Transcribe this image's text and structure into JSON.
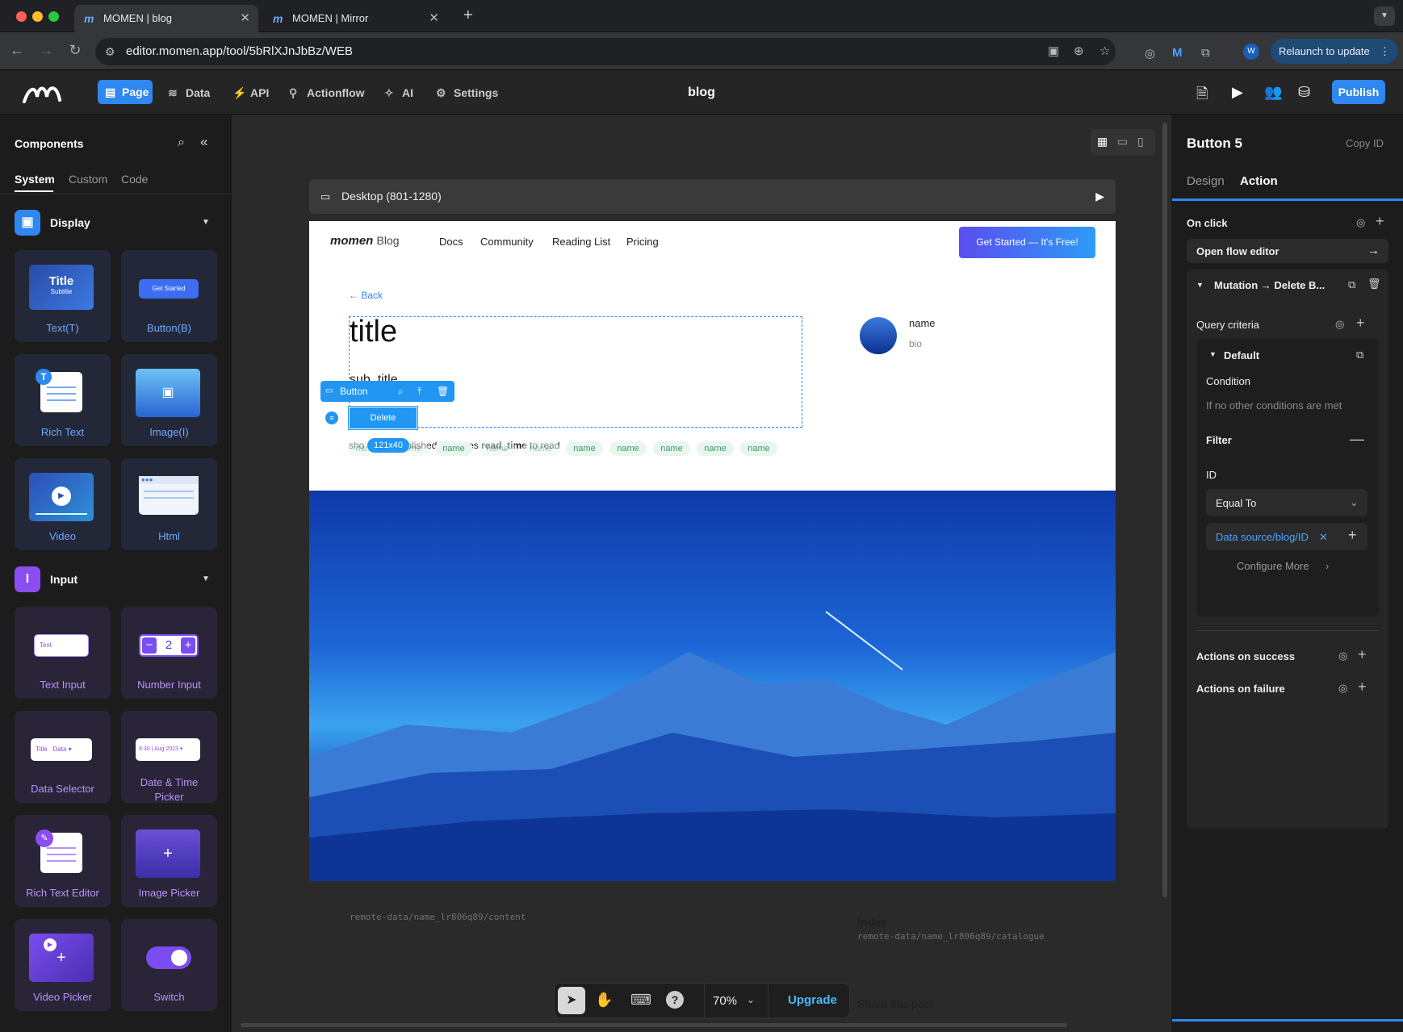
{
  "browser": {
    "tabs": [
      {
        "title": "MOMEN | blog",
        "active": true
      },
      {
        "title": "MOMEN | Mirror",
        "active": false
      }
    ],
    "new_tab": "+",
    "url": "editor.momen.app/tool/5bRlXJnJbBz/WEB",
    "relaunch_label": "Relaunch to update",
    "profile_initial": "W"
  },
  "app": {
    "title": "blog",
    "menu": [
      {
        "label": "Page",
        "icon": "page-icon",
        "active": true
      },
      {
        "label": "Data",
        "icon": "database-icon"
      },
      {
        "label": "API",
        "icon": "api-icon"
      },
      {
        "label": "Actionflow",
        "icon": "flow-icon"
      },
      {
        "label": "AI",
        "icon": "ai-icon"
      },
      {
        "label": "Settings",
        "icon": "gear-icon"
      }
    ],
    "publish_label": "Publish"
  },
  "components_panel": {
    "title": "Components",
    "tabs": [
      "System",
      "Custom",
      "Code"
    ],
    "active_tab": "System",
    "display_section": "Display",
    "display_items": [
      "Text(T)",
      "Button(B)",
      "Rich Text",
      "Image(I)",
      "Video",
      "Html"
    ],
    "input_section": "Input",
    "input_items": [
      "Text Input",
      "Number Input",
      "Data Selector",
      "Date & Time Picker",
      "Rich Text Editor",
      "Image Picker",
      "Video Picker",
      "Switch"
    ],
    "thumbs": {
      "title_text": "Title",
      "subtitle_text": "Subtitle",
      "button_text": "Get Started",
      "text_input_text": "Text",
      "number_value": "2",
      "selector_title": "Title",
      "selector_data": "Data",
      "date_time": "8:30",
      "date_date": "Aug 2023"
    }
  },
  "canvas": {
    "device_label": "Desktop (801-1280)",
    "zoom": "70%",
    "upgrade_label": "Upgrade"
  },
  "preview": {
    "logo": "momen",
    "logo_suffix": "Blog",
    "nav": [
      "Docs",
      "Community",
      "Reading List",
      "Pricing"
    ],
    "cta": "Get Started — It's Free!",
    "back": "← Back",
    "title": "title",
    "subtitle": "sub_title",
    "author_name": "name",
    "author_bio": "bio",
    "meta_short": "sho",
    "meta_published": "blished",
    "meta_takes": "Takes",
    "meta_read_time": "read_time",
    "meta_to_read": "to read",
    "tags": [
      "name",
      "name",
      "name",
      "name",
      "name",
      "name",
      "name",
      "name",
      "name",
      "name"
    ],
    "selected_type": "Button",
    "selected_label": "Delete",
    "size_badge": "121x40"
  },
  "below_page": {
    "content_path": "remote-data/name_lr806q89/content",
    "index_label": "Index",
    "catalogue_path": "remote-data/name_lr806q89/catalogue",
    "share_label": "Share this post"
  },
  "inspector": {
    "component_name": "Button 5",
    "copy_id": "Copy ID",
    "tabs": [
      "Design",
      "Action"
    ],
    "active_tab": "Action",
    "on_click": "On click",
    "open_flow_editor": "Open flow editor",
    "mutation": "Mutation → Delete B...",
    "query_criteria": "Query criteria",
    "default": "Default",
    "condition": "Condition",
    "condition_value": "If no other conditions are met",
    "filter": "Filter",
    "field": "ID",
    "operator": "Equal To",
    "data_source": "Data source/blog/ID",
    "configure_more": "Configure More",
    "actions_on_success": "Actions on success",
    "actions_on_failure": "Actions on failure"
  },
  "colors": {
    "accent": "#2f87f0",
    "background": "#1c1c1c",
    "cta_gradient_start": "#5b4df0",
    "tag_green": "#3a9b66",
    "selection_blue": "#2196f3"
  }
}
